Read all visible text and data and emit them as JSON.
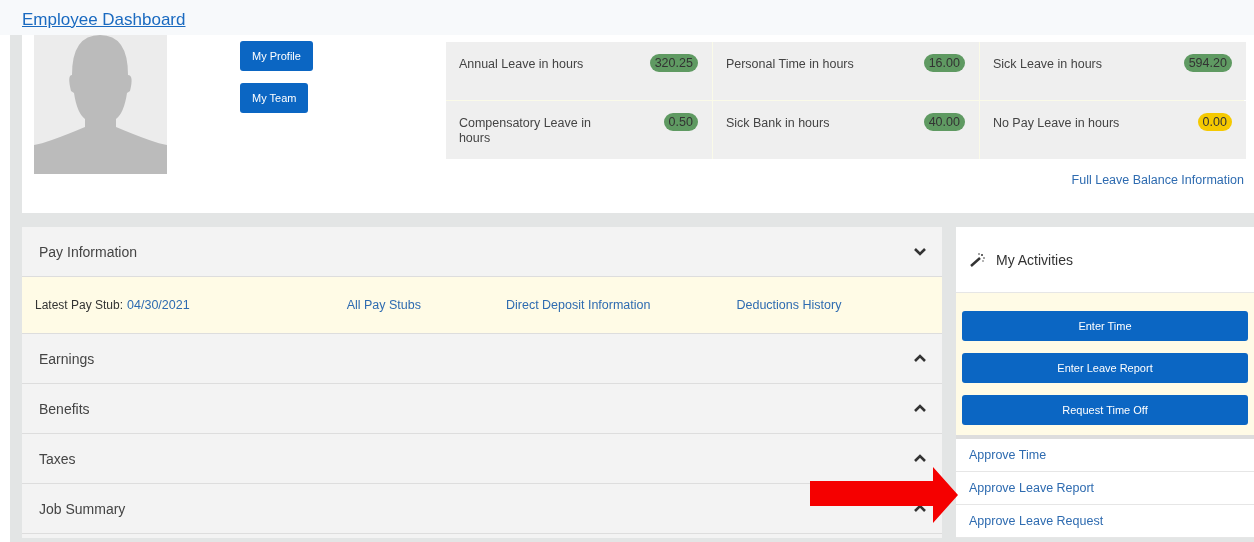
{
  "header": {
    "title": "Employee Dashboard"
  },
  "profile": {
    "buttons": [
      "My Profile",
      "My Team"
    ]
  },
  "leave_balances": [
    {
      "label": "Annual Leave in hours",
      "value": "320.25",
      "color": "#5f9a62"
    },
    {
      "label": "Personal Time in hours",
      "value": "16.00",
      "color": "#5f9a62"
    },
    {
      "label": "Sick Leave in hours",
      "value": "594.20",
      "color": "#5f9a62"
    },
    {
      "label": "Compensatory Leave in hours",
      "value": "0.50",
      "color": "#5f9a62"
    },
    {
      "label": "Sick Bank in hours",
      "value": "40.00",
      "color": "#5f9a62"
    },
    {
      "label": "No Pay Leave in hours",
      "value": "0.00",
      "color": "#f5c900"
    }
  ],
  "full_leave_link": "Full Leave Balance Information",
  "sections": [
    {
      "title": "Pay Information",
      "expanded": true,
      "pay_stub_label": "Latest Pay Stub:",
      "pay_stub_date": "04/30/2021",
      "links": [
        "All Pay Stubs",
        "Direct Deposit Information",
        "Deductions History"
      ]
    },
    {
      "title": "Earnings",
      "expanded": false
    },
    {
      "title": "Benefits",
      "expanded": false
    },
    {
      "title": "Taxes",
      "expanded": false
    },
    {
      "title": "Job Summary",
      "expanded": false
    }
  ],
  "activities": {
    "title": "My Activities",
    "buttons": [
      "Enter Time",
      "Enter Leave Report",
      "Request Time Off"
    ],
    "links": [
      "Approve Time",
      "Approve Leave Report",
      "Approve Leave Request"
    ]
  }
}
